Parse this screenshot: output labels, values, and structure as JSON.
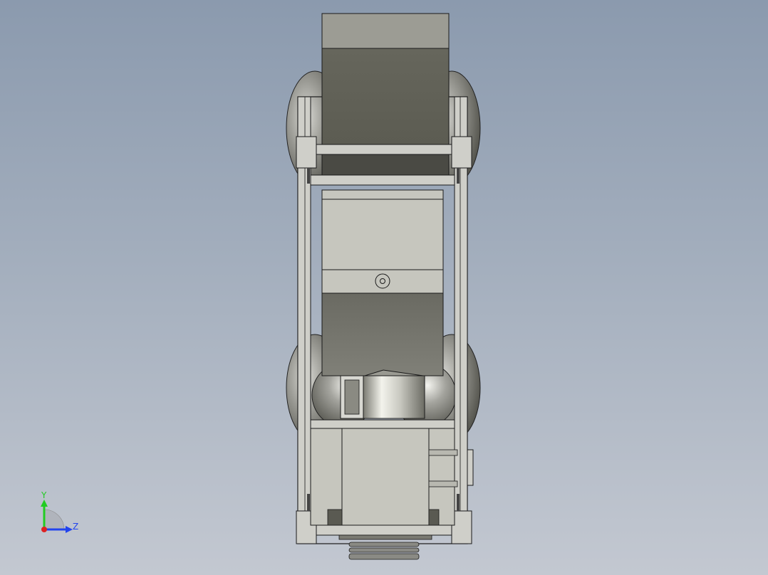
{
  "viewport": {
    "background_top": "#8b9aae",
    "background_bottom": "#c3c8d1"
  },
  "model": {
    "frame_color": "#cfcfc9",
    "motor_dark_color": "#636358",
    "panel_light_color": "#c6c6be",
    "wheel_color": "#8e8e88",
    "edge_color": "#1a1a1a"
  },
  "triad": {
    "y_label": "Y",
    "z_label": "Z",
    "y_color": "#22cc22",
    "z_color": "#2244ee",
    "origin_color": "#dd2222"
  }
}
